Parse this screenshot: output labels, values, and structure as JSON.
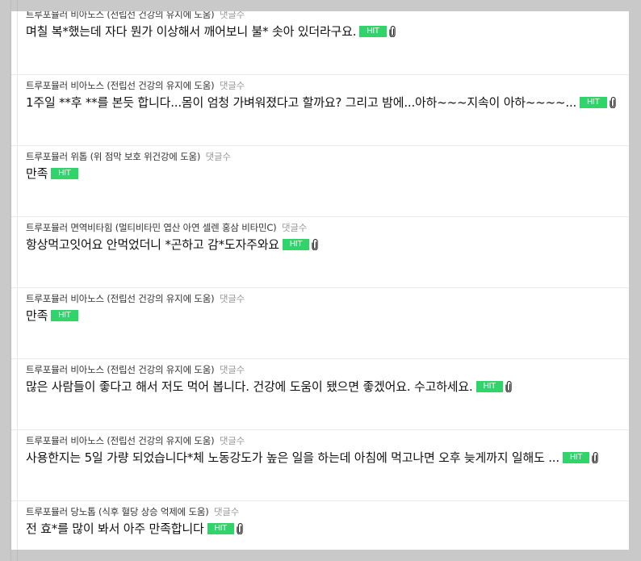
{
  "theme": {
    "badge_color": "#2fd46b",
    "background": "#c9c9c9"
  },
  "reviews": [
    {
      "product": "트루포뮬러 비아노스 (전립선 건강의 유지에 도움)",
      "comments_label": "댓글수",
      "text": "며칠 복*했는데 자다 뭔가 이상해서 깨어보니 불* 솟아 있더라구요.",
      "badge": "HIT",
      "attachment_icon": "paperclip-icon"
    },
    {
      "product": "트루포뮬러 비아노스 (전립선 건강의 유지에 도움)",
      "comments_label": "댓글수",
      "text": "1주일 **후 **를 본듯 합니다...몸이 엄청 가벼워졌다고 할까요? 그리고 밤에...아하~~~지속이 아하~~~~...",
      "badge": "HIT",
      "attachment_icon": "paperclip-icon"
    },
    {
      "product": "트루포뮬러 위톱 (위 점막 보호 위건강에 도움)",
      "comments_label": "댓글수",
      "text": "만족",
      "badge": "HIT",
      "attachment_icon": ""
    },
    {
      "product": "트루포뮬러 면역비타힘 (멀티비타민 엽산 아연 셀렌 홍삼 비타민C)",
      "comments_label": "댓글수",
      "text": "항상먹고잇어요 안먹었더니 *곤하고 감*도자주와요",
      "badge": "HIT",
      "attachment_icon": "paperclip-icon"
    },
    {
      "product": "트루포뮬러 비아노스 (전립선 건강의 유지에 도움)",
      "comments_label": "댓글수",
      "text": "만족",
      "badge": "HIT",
      "attachment_icon": ""
    },
    {
      "product": "트루포뮬러 비아노스 (전립선 건강의 유지에 도움)",
      "comments_label": "댓글수",
      "text": "많은 사람들이 좋다고 해서 저도 먹어 봅니다. 건강에 도움이 됐으면 좋겠어요. 수고하세요.",
      "badge": "HIT",
      "attachment_icon": "paperclip-icon"
    },
    {
      "product": "트루포뮬러 비아노스 (전립선 건강의 유지에 도움)",
      "comments_label": "댓글수",
      "text": "사용한지는 5일 가량 되었습니다*체 노동강도가 높은 일을 하는데 아침에 먹고나면 오후 늦게까지 일해도 ...",
      "badge": "HIT",
      "attachment_icon": "paperclip-icon"
    },
    {
      "product": "트루포뮬러 당노톱 (식후 혈당 상승 억제에 도움)",
      "comments_label": "댓글수",
      "text": "전 효*를 많이 봐서 아주 만족합니다",
      "badge": "HIT",
      "attachment_icon": "paperclip-icon"
    }
  ]
}
